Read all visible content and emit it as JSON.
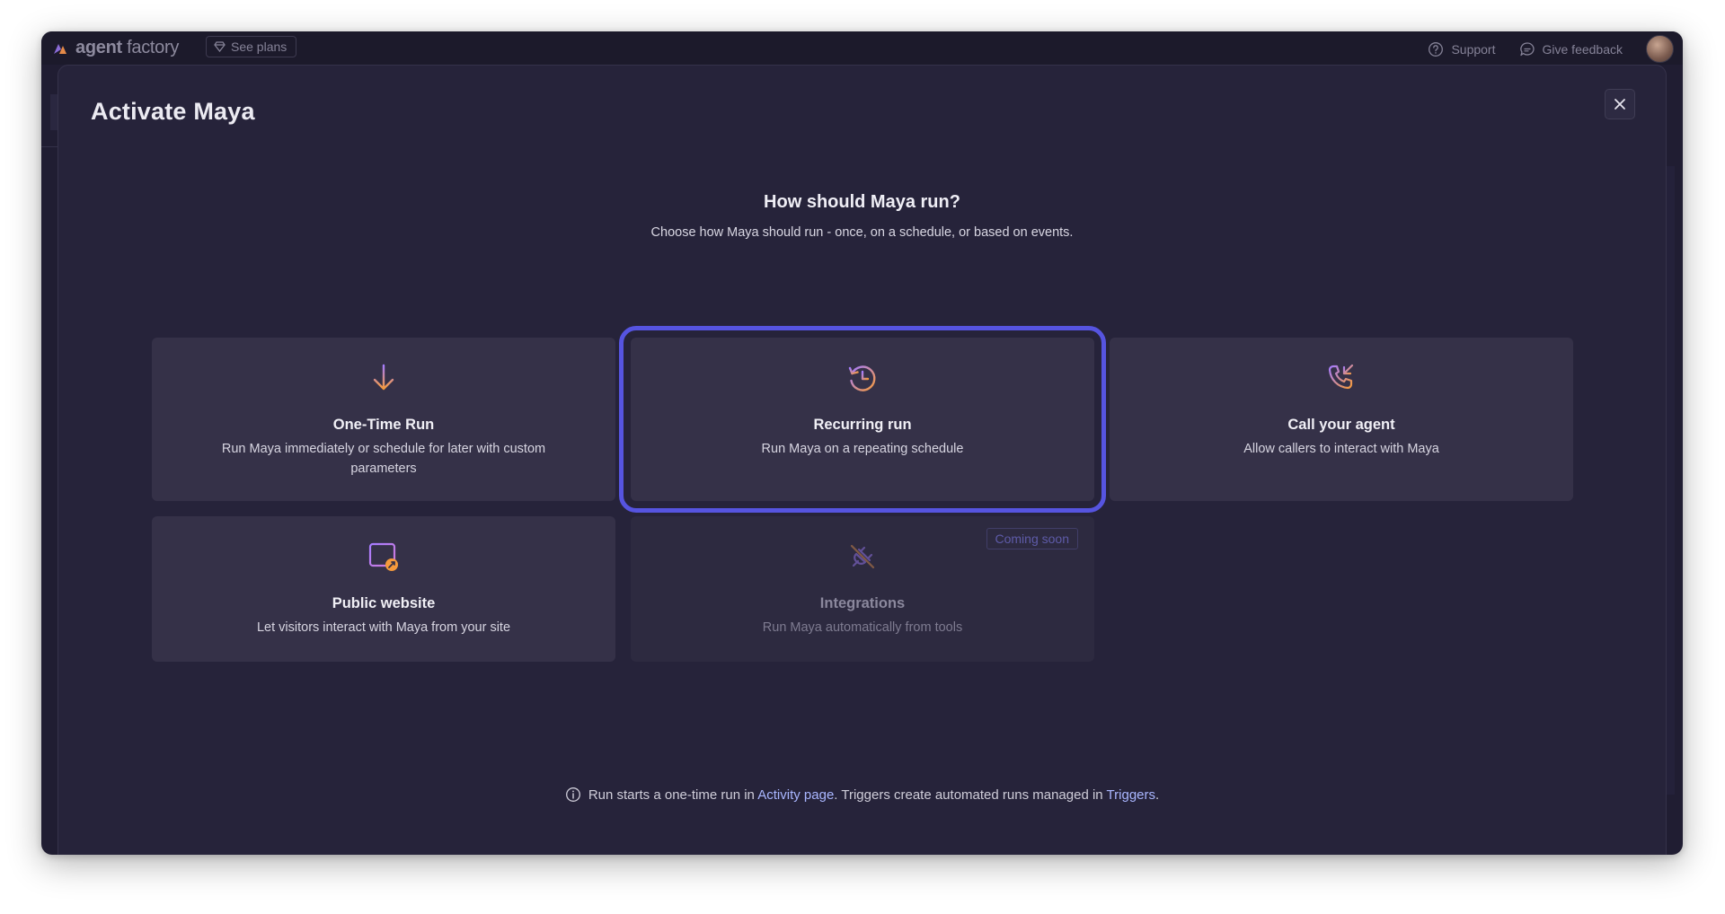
{
  "topbar": {
    "brand_bold": "agent",
    "brand_light": "factory",
    "plans_label": "See plans",
    "support_label": "Support",
    "feedback_label": "Give feedback"
  },
  "modal": {
    "title": "Activate Maya",
    "heading": "How should Maya run?",
    "subheading": "Choose how Maya should run - once, on a schedule, or based on events.",
    "close_icon": "close-icon",
    "options": [
      {
        "id": "one-time-run",
        "title": "One-Time Run",
        "description": "Run Maya immediately or schedule for later with custom parameters",
        "icon": "arrow-down-icon",
        "selected": false,
        "disabled": false
      },
      {
        "id": "recurring-run",
        "title": "Recurring run",
        "description": "Run Maya on a repeating schedule",
        "icon": "history-clock-icon",
        "selected": true,
        "disabled": false
      },
      {
        "id": "call-your-agent",
        "title": "Call your agent",
        "description": "Allow callers to interact with Maya",
        "icon": "phone-incoming-icon",
        "selected": false,
        "disabled": false
      },
      {
        "id": "public-website",
        "title": "Public website",
        "description": "Let visitors interact with Maya from your site",
        "icon": "browser-window-icon",
        "selected": false,
        "disabled": false
      },
      {
        "id": "integrations",
        "title": "Integrations",
        "description": "Run Maya automatically from tools",
        "icon": "plug-off-icon",
        "selected": false,
        "disabled": true,
        "badge": "Coming soon"
      }
    ],
    "footer": {
      "text_before": "Run starts a one-time run in",
      "activity_link": "Activity page",
      "text_middle": ". Triggers create automated runs managed in",
      "triggers_link": "Triggers",
      "text_after": "."
    }
  },
  "colors": {
    "accent_selection": "#5654e0",
    "icon_gradient_start": "#a57cff",
    "icon_gradient_end": "#f59a3c",
    "link": "#a9b6ff",
    "modal_background": "#26233a",
    "card_background": "#353148"
  }
}
